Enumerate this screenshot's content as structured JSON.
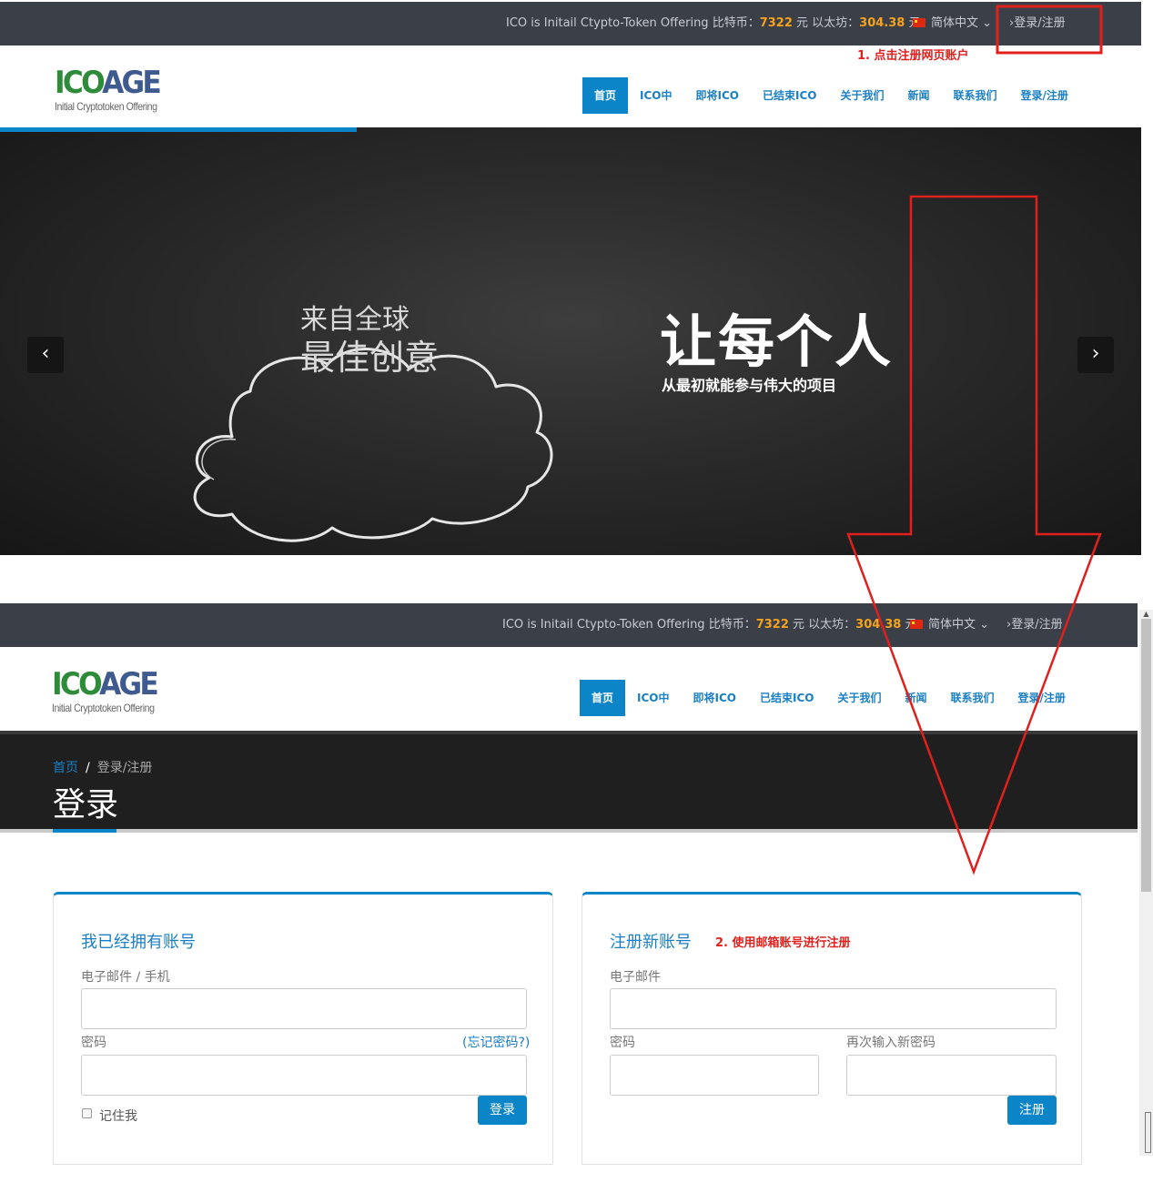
{
  "site": {
    "logo_brand_ico": "ICO",
    "logo_brand_age": "AGE",
    "logo_tagline": "Initial Cryptotoken Offering"
  },
  "topbar": {
    "info_prefix": "ICO is Initail Ctypto-Token Offering 比特币：",
    "btc_price": "7322",
    "info_mid": " 元 以太坊：",
    "eth_price": "304.38",
    "info_suffix": " 元",
    "language": "简体中文",
    "login_link": "登录/注册"
  },
  "nav": {
    "items": [
      {
        "label": "首页"
      },
      {
        "label": "ICO中"
      },
      {
        "label": "即将ICO"
      },
      {
        "label": "已结束ICO"
      },
      {
        "label": "关于我们"
      },
      {
        "label": "新闻"
      },
      {
        "label": "联系我们"
      },
      {
        "label": "登录/注册"
      }
    ]
  },
  "hero": {
    "cloud_line1": "来自全球",
    "cloud_line2": "最佳创意",
    "headline": "让每个人",
    "subline": "从最初就能参与伟大的项目",
    "prev_icon": "chevron-left-icon",
    "next_icon": "chevron-right-icon"
  },
  "pagehead": {
    "crumb_home": "首页",
    "crumb_separator": "/",
    "crumb_current": "登录/注册",
    "title": "登录"
  },
  "login_card": {
    "title": "我已经拥有账号",
    "email_label": "电子邮件 / 手机",
    "password_label": "密码",
    "forgot_link": "(忘记密码?)",
    "remember_label": "记住我",
    "submit": "登录"
  },
  "register_card": {
    "title": "注册新账号",
    "email_label": "电子邮件",
    "password_label": "密码",
    "repeat_label": "再次输入新密码",
    "submit": "注册"
  },
  "annotations": {
    "step1": "1. 点击注册网页账户",
    "step2": "2. 使用邮箱账号进行注册"
  },
  "colors": {
    "accent": "#0b85c8",
    "topbar": "#3a3f48",
    "price": "#f7a21b",
    "annotation": "#e0201c"
  }
}
